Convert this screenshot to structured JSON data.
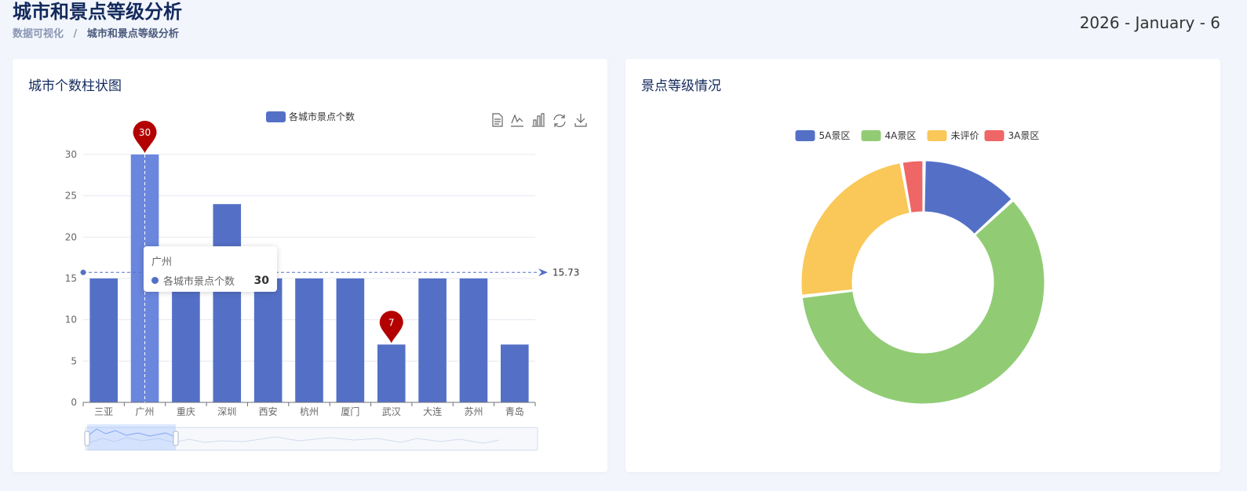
{
  "header": {
    "title": "城市和景点等级分析",
    "breadcrumb": [
      "数据可视化",
      "城市和景点等级分析"
    ],
    "breadcrumb_sep": "/",
    "date": "2026 - January - 6"
  },
  "bar_card": {
    "title": "城市个数柱状图",
    "legend": "各城市景点个数",
    "toolbox": [
      "data-view-icon",
      "line-chart-icon",
      "bar-chart-icon",
      "restore-icon",
      "download-icon"
    ],
    "average_label": "15.73",
    "max_pin": "30",
    "min_pin": "7",
    "tooltip": {
      "title": "广州",
      "series": "各城市景点个数",
      "value": "30"
    }
  },
  "pie_card": {
    "title": "景点等级情况"
  },
  "chart_data": [
    {
      "type": "bar",
      "categories": [
        "三亚",
        "广州",
        "重庆",
        "深圳",
        "西安",
        "杭州",
        "厦门",
        "武汉",
        "大连",
        "苏州",
        "青岛"
      ],
      "series": [
        {
          "name": "各城市景点个数",
          "values": [
            15,
            30,
            15,
            24,
            15,
            15,
            15,
            7,
            15,
            15,
            7
          ]
        }
      ],
      "ylim": [
        0,
        30
      ],
      "yticks": [
        "0",
        "5",
        "10",
        "15",
        "20",
        "25",
        "30"
      ],
      "average": 15.73,
      "color": "#5470c6",
      "highlight_color": "#6a86dd",
      "pin_color": "#b30000",
      "grid": true,
      "legend_position": "top"
    },
    {
      "type": "pie",
      "labels": [
        "5A景区",
        "4A景区",
        "未评价",
        "3A景区"
      ],
      "values": [
        13,
        60,
        24,
        3
      ],
      "colors": [
        "#5470c6",
        "#91cc75",
        "#fac858",
        "#ee6666"
      ],
      "legend_position": "top"
    }
  ]
}
